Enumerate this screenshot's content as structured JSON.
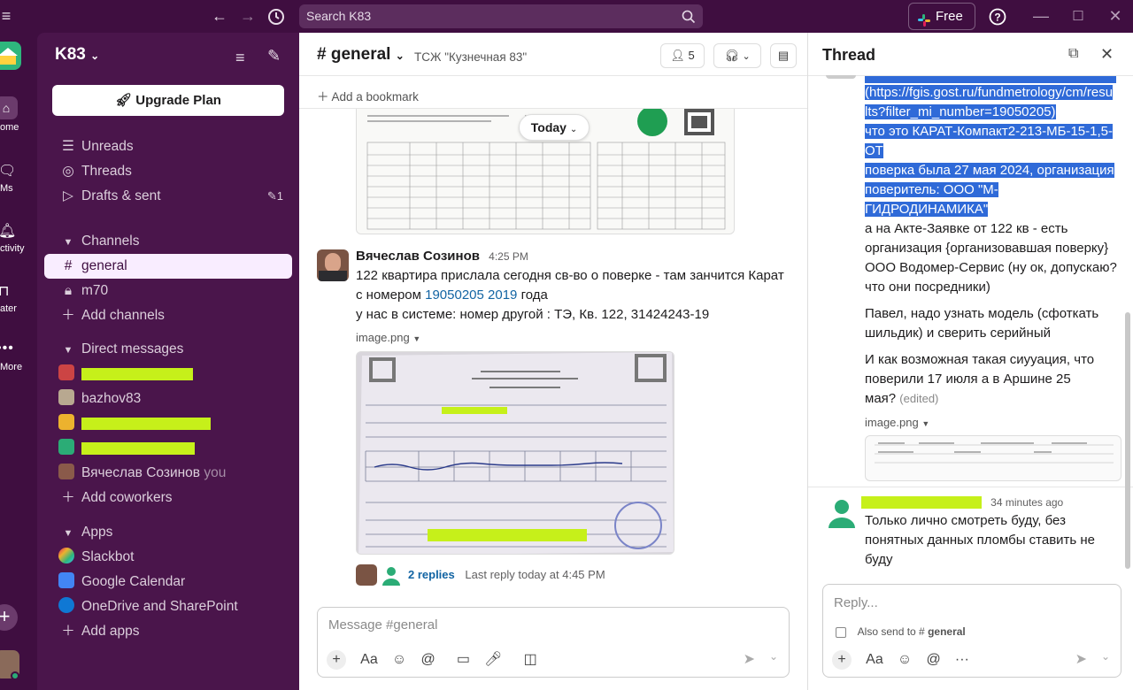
{
  "topbar": {
    "search_placeholder": "Search K83",
    "free_label": "Free"
  },
  "rail": {
    "home": "ome",
    "dms": "Ms",
    "activity": "ctivity",
    "later": "ater",
    "more": "More"
  },
  "sidebar": {
    "workspace": "K83",
    "upgrade": "Upgrade Plan",
    "unreads": "Unreads",
    "threads": "Threads",
    "drafts": "Drafts & sent",
    "drafts_count": "1",
    "channels_header": "Channels",
    "channels": [
      {
        "name": "general",
        "active": true
      },
      {
        "name": "m70",
        "locked": true
      }
    ],
    "add_channels": "Add channels",
    "dm_header": "Direct messages",
    "dms": [
      {
        "label": "bazhov83"
      },
      {
        "label": "Вячеслав Созинов",
        "suffix": "you"
      }
    ],
    "add_coworkers": "Add coworkers",
    "apps_header": "Apps",
    "apps": [
      "Slackbot",
      "Google Calendar",
      "OneDrive and SharePoint"
    ],
    "add_apps": "Add apps"
  },
  "channel": {
    "name": "general",
    "description": "ТСЖ \"Кузнечная 83\"",
    "members": "5",
    "bookmark": "Add a bookmark",
    "today": "Today",
    "message": {
      "author": "Вячеслав Созинов",
      "time": "4:25 PM",
      "line1": "122  квартира прислала сегодня св-во о поверке - там занчится Карат",
      "line2_pre": "с номером ",
      "line2_link": "19050205 2019",
      "line2_post": " года",
      "line3": "у нас в системе:  номер другой : ТЭ, Кв. 122, 31424243-19",
      "attachment": "image.png",
      "replies": "2 replies",
      "last_reply": "Last reply today at 4:45 PM"
    },
    "composer_placeholder": "Message #general"
  },
  "thread": {
    "title": "Thread",
    "sel_lines": [
      "(https://fgis.gost.ru/fundmetrology/cm/resu",
      "lts?filter_mi_number=19050205)",
      "что это КАРАТ-Компакт2-213-МБ-15-1,5-",
      "ОТ",
      "поверка была 27 мая 2024, организация",
      "поверитель: ООО \"М-",
      "ГИДРОДИНАМИКА\""
    ],
    "p1": [
      "а на Акте-Заявке от 122 кв - есть",
      "организация {организовавшая поверку}",
      "ООО Водомер-Сервис (ну ок, допускаю?",
      "что они посредники)"
    ],
    "p2": [
      "Павел, надо узнать модель (сфоткать",
      "шильдик) и сверить серийный"
    ],
    "p3": [
      "И как возможная такая сиууация, что",
      "поверили 17 июля а в Аршине 25"
    ],
    "p3_last": "мая?",
    "edited": "(edited)",
    "attachment": "image.png",
    "reply_time": "34 minutes ago",
    "reply_lines": [
      "Только лично смотреть буду, без",
      "понятных данных пломбы ставить не",
      "буду"
    ],
    "reply_placeholder": "Reply...",
    "also_send": "Also send to",
    "also_channel": "general"
  }
}
